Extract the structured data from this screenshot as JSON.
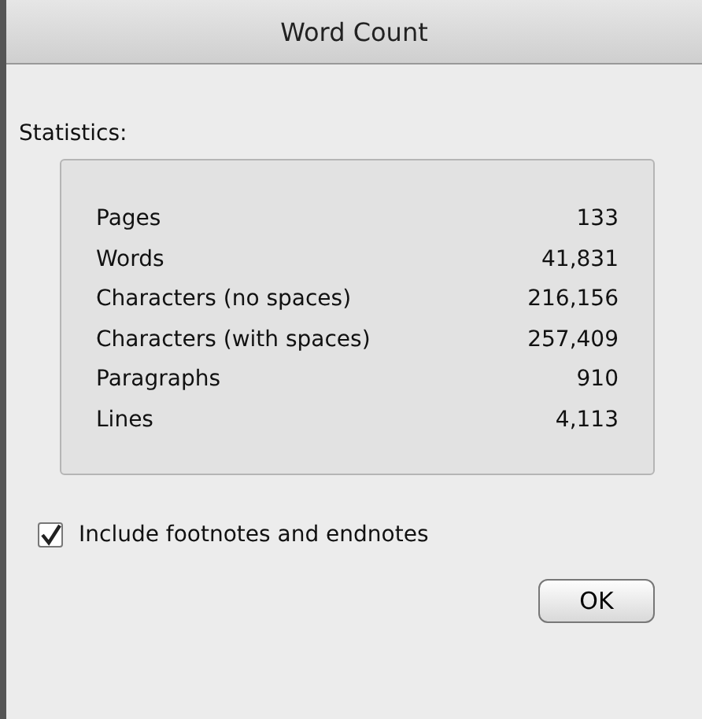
{
  "window": {
    "title": "Word Count"
  },
  "statistics": {
    "label": "Statistics:",
    "rows": [
      {
        "name": "Pages",
        "value": "133"
      },
      {
        "name": "Words",
        "value": "41,831"
      },
      {
        "name": "Characters (no spaces)",
        "value": "216,156"
      },
      {
        "name": "Characters (with spaces)",
        "value": "257,409"
      },
      {
        "name": "Paragraphs",
        "value": "910"
      },
      {
        "name": "Lines",
        "value": "4,113"
      }
    ]
  },
  "include_footnotes": {
    "label": "Include footnotes and endnotes",
    "checked": true
  },
  "buttons": [
    "OK"
  ]
}
